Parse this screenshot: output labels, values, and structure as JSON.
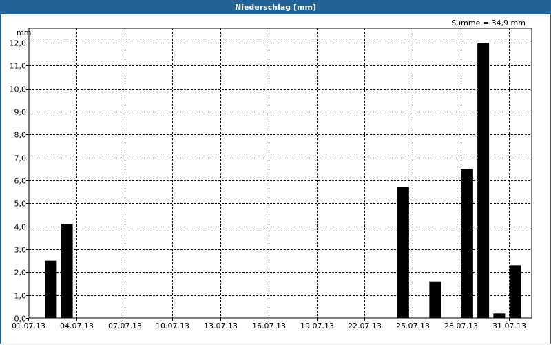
{
  "window": {
    "title": "Niederschlag [mm]"
  },
  "summary": {
    "text": "Summe = 34,9 mm"
  },
  "chart_data": {
    "type": "bar",
    "title": "Niederschlag [mm]",
    "ylabel": "mm",
    "xlabel": "",
    "ylim": [
      0,
      12.0
    ],
    "yticks": [
      "0,0",
      "1,0",
      "2,0",
      "3,0",
      "4,0",
      "5,0",
      "6,0",
      "7,0",
      "8,0",
      "9,0",
      "10,0",
      "11,0",
      "12,0"
    ],
    "xticks": [
      "01.07.13",
      "04.07.13",
      "07.07.13",
      "10.07.13",
      "13.07.13",
      "16.07.13",
      "19.07.13",
      "22.07.13",
      "25.07.13",
      "28.07.13",
      "31.07.13"
    ],
    "grid": true,
    "bars": [
      {
        "date": "02.07.13",
        "value": 2.5
      },
      {
        "date": "03.07.13",
        "value": 4.1
      },
      {
        "date": "24.07.13",
        "value": 5.7
      },
      {
        "date": "26.07.13",
        "value": 1.6
      },
      {
        "date": "28.07.13",
        "value": 6.5
      },
      {
        "date": "29.07.13",
        "value": 12.0
      },
      {
        "date": "30.07.13",
        "value": 0.2
      },
      {
        "date": "31.07.13",
        "value": 2.3
      }
    ],
    "colors": {
      "bar": "#000000",
      "grid": "#000000",
      "title_bg": "#216397"
    }
  }
}
